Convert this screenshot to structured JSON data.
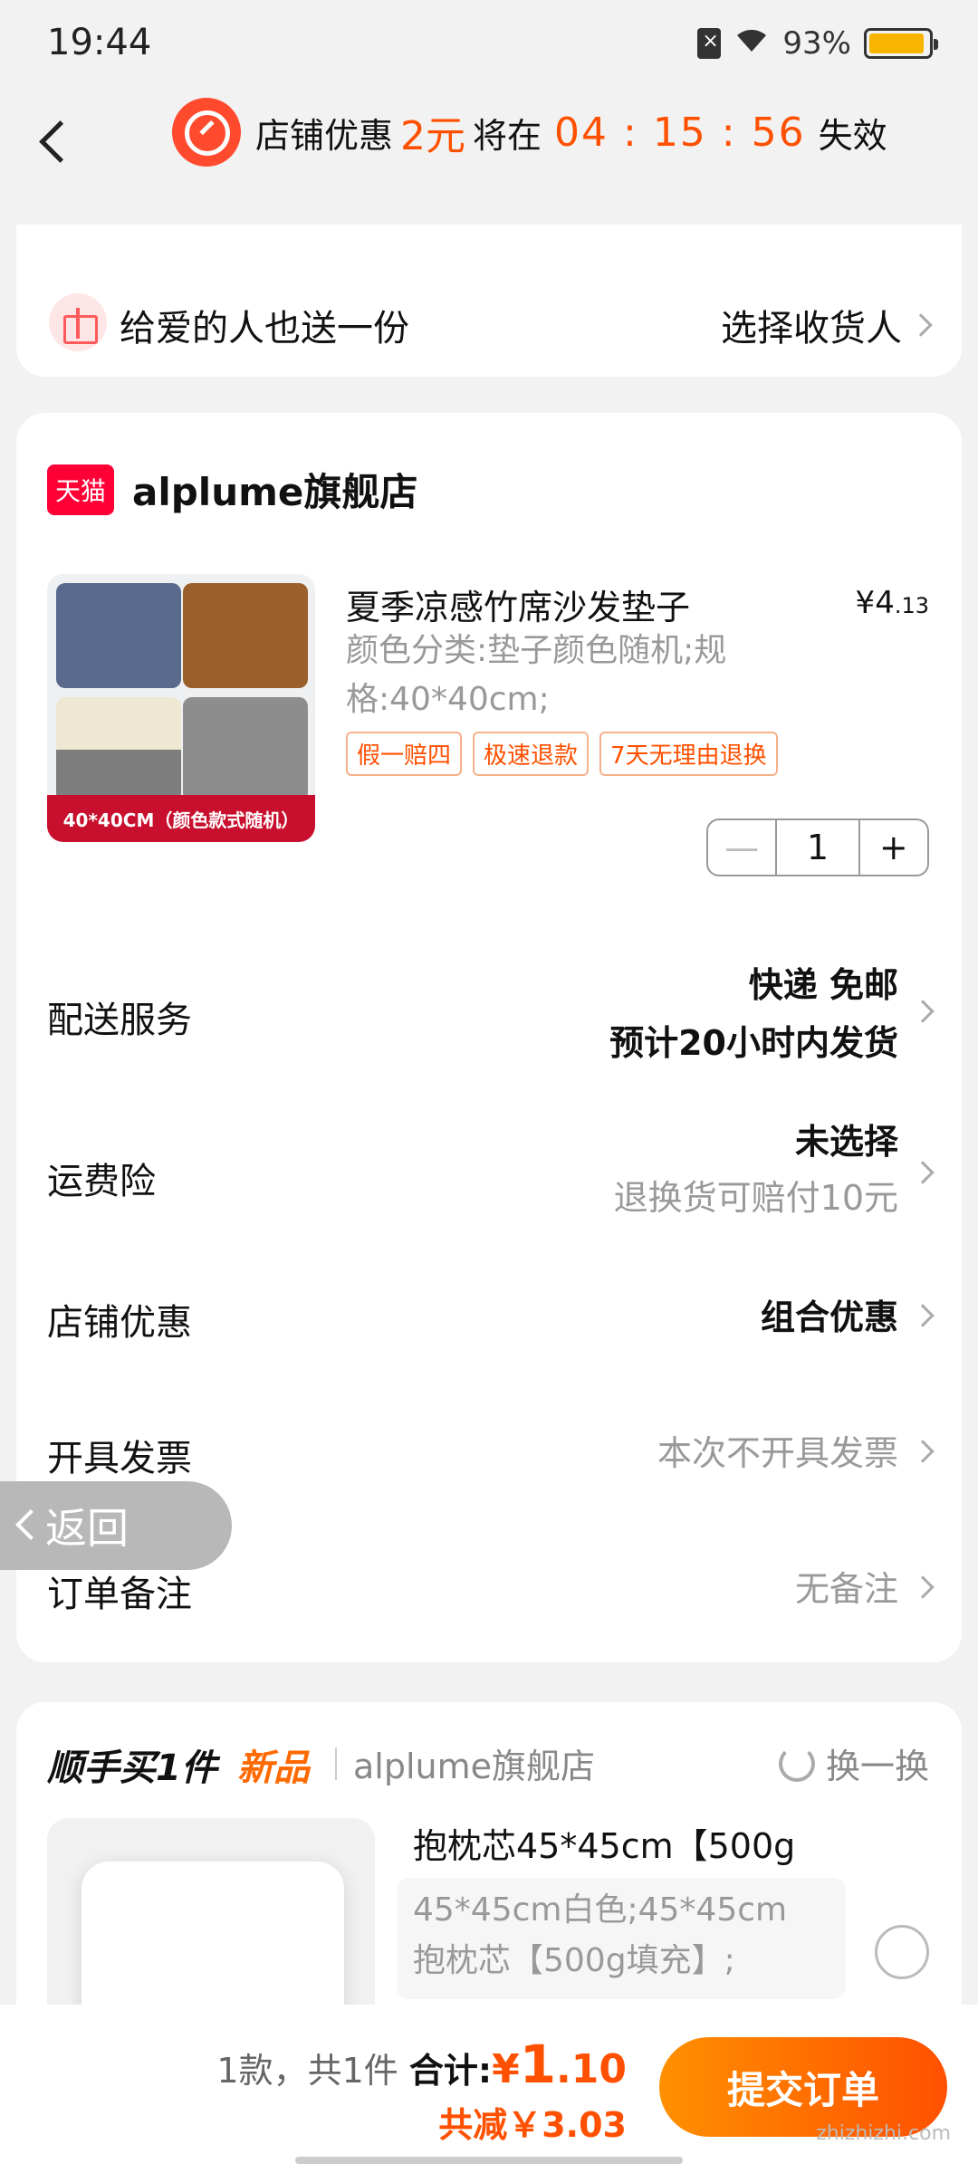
{
  "status_bar": {
    "time": "19:44",
    "battery": "93%"
  },
  "header": {
    "promo_label": "店铺优惠",
    "promo_amount": "2元",
    "promo_mid": "将在",
    "countdown": "04 : 15 : 56",
    "promo_end": "失效"
  },
  "gift": {
    "label": "给爱的人也送一份",
    "action": "选择收货人"
  },
  "store": {
    "badge": "天猫",
    "name": "alplume旗舰店"
  },
  "product": {
    "image_caption": "40*40CM（颜色款式随机）",
    "title": "夏季凉感竹席沙发垫子",
    "price_symbol": "¥",
    "price_int": "4",
    "price_dec": ".13",
    "spec": "颜色分类:垫子颜色随机;规格:40*40cm;",
    "tags": [
      "假一赔四",
      "极速退款",
      "7天无理由退换"
    ],
    "quantity": "1",
    "minus": "—",
    "plus": "+"
  },
  "rows": {
    "delivery": {
      "label": "配送服务",
      "line1": "快递 免邮",
      "line2": "预计20小时内发货"
    },
    "insurance": {
      "label": "运费险",
      "line1": "未选择",
      "line2": "退换货可赔付10元"
    },
    "discount": {
      "label": "店铺优惠",
      "value": "组合优惠"
    },
    "invoice": {
      "label": "开具发票",
      "value": "本次不开具发票"
    },
    "note": {
      "label": "订单备注",
      "value": "无备注"
    }
  },
  "float_back": "返回",
  "addon": {
    "title": "顺手买1件",
    "new_label": "新品",
    "store": "alplume旗舰店",
    "refresh": "换一换",
    "name": "抱枕芯45*45cm【500g",
    "spec_line1": "45*45cm白色;45*45cm",
    "spec_line2": "抱枕芯【500g填充】;"
  },
  "bottom": {
    "count_text": "1款，共1件",
    "total_label": "合计:",
    "total_symbol": "¥",
    "total_int": "1",
    "total_dec": ".10",
    "saved": "共减￥3.03",
    "submit": "提交订单"
  },
  "watermark": "zhizhizhi.com"
}
